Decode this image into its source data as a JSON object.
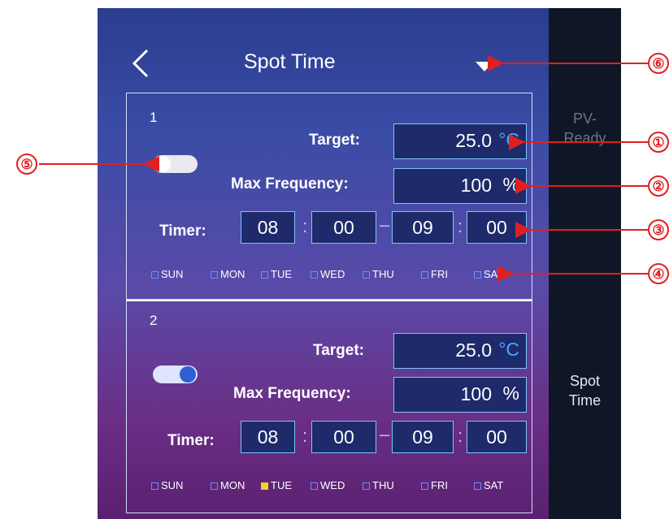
{
  "header": {
    "title": "Spot Time",
    "back_icon": "chevron-left-icon",
    "menu_icon": "triangle-down-icon"
  },
  "side": {
    "top_label_1": "PV-",
    "top_label_2": "Ready",
    "bottom_label_1": "Spot",
    "bottom_label_2": "Time"
  },
  "panels": [
    {
      "number": "1",
      "toggle_on": false,
      "target_label": "Target:",
      "target_value": "25.0",
      "target_unit": "°C",
      "freq_label": "Max Frequency:",
      "freq_value": "100",
      "freq_unit": "%",
      "timer_label": "Timer:",
      "timer": [
        "08",
        "00",
        "09",
        "00"
      ],
      "days": [
        "SUN",
        "MON",
        "TUE",
        "WED",
        "THU",
        "FRI",
        "SAT"
      ],
      "days_checked": [
        false,
        false,
        false,
        false,
        false,
        false,
        false
      ]
    },
    {
      "number": "2",
      "toggle_on": true,
      "target_label": "Target:",
      "target_value": "25.0",
      "target_unit": "°C",
      "freq_label": "Max Frequency:",
      "freq_value": "100",
      "freq_unit": "%",
      "timer_label": "Timer:",
      "timer": [
        "08",
        "00",
        "09",
        "00"
      ],
      "days": [
        "SUN",
        "MON",
        "TUE",
        "WED",
        "THU",
        "FRI",
        "SAT"
      ],
      "days_checked": [
        false,
        false,
        true,
        false,
        false,
        false,
        false
      ]
    }
  ],
  "callouts": [
    "①",
    "②",
    "③",
    "④",
    "⑤",
    "⑥"
  ],
  "colors": {
    "callout": "#e02020",
    "unit_celsius": "#4aa8ff",
    "checked_day": "#f3d12a"
  }
}
